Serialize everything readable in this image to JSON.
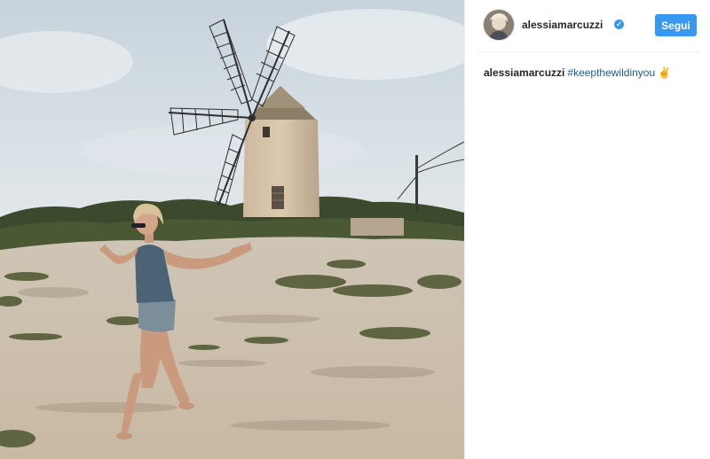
{
  "post": {
    "username": "alessiamarcuzzi",
    "verified_icon": "check-icon",
    "follow_label": "Segui",
    "caption_user": "alessiamarcuzzi",
    "caption_hashtag": "#keepthewildinyou",
    "caption_emoji": "✌"
  },
  "colors": {
    "accent": "#3897f0",
    "hashtag": "#1e5a9c",
    "text": "#262626"
  }
}
